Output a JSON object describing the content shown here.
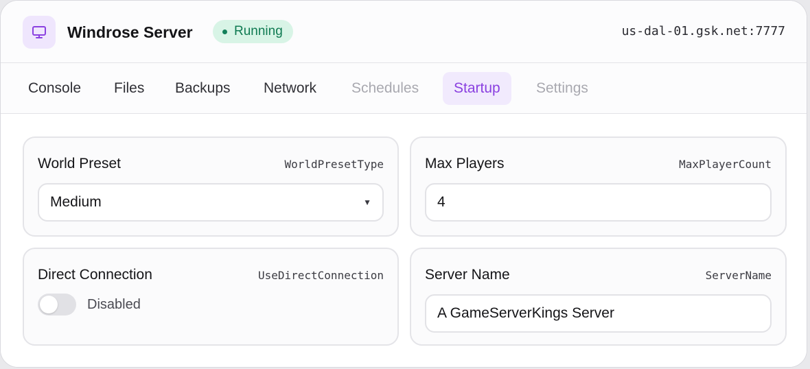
{
  "header": {
    "icon": "monitor-icon",
    "title": "Windrose Server",
    "status": "Running",
    "status_color": "#0f7a52",
    "address": "us-dal-01.gsk.net:7777"
  },
  "tabs": [
    {
      "label": "Console",
      "state": "normal"
    },
    {
      "label": "Files",
      "state": "normal"
    },
    {
      "label": "Backups",
      "state": "normal"
    },
    {
      "label": "Network",
      "state": "normal"
    },
    {
      "label": "Schedules",
      "state": "disabled"
    },
    {
      "label": "Startup",
      "state": "active"
    },
    {
      "label": "Settings",
      "state": "disabled"
    }
  ],
  "accent_color": "#8a40e0",
  "settings": {
    "world_preset": {
      "label": "World Preset",
      "key": "WorldPresetType",
      "value": "Medium"
    },
    "max_players": {
      "label": "Max Players",
      "key": "MaxPlayerCount",
      "value": "4"
    },
    "direct_connection": {
      "label": "Direct Connection",
      "key": "UseDirectConnection",
      "value": "Disabled",
      "enabled": false
    },
    "server_name": {
      "label": "Server Name",
      "key": "ServerName",
      "value": "A GameServerKings Server"
    }
  }
}
